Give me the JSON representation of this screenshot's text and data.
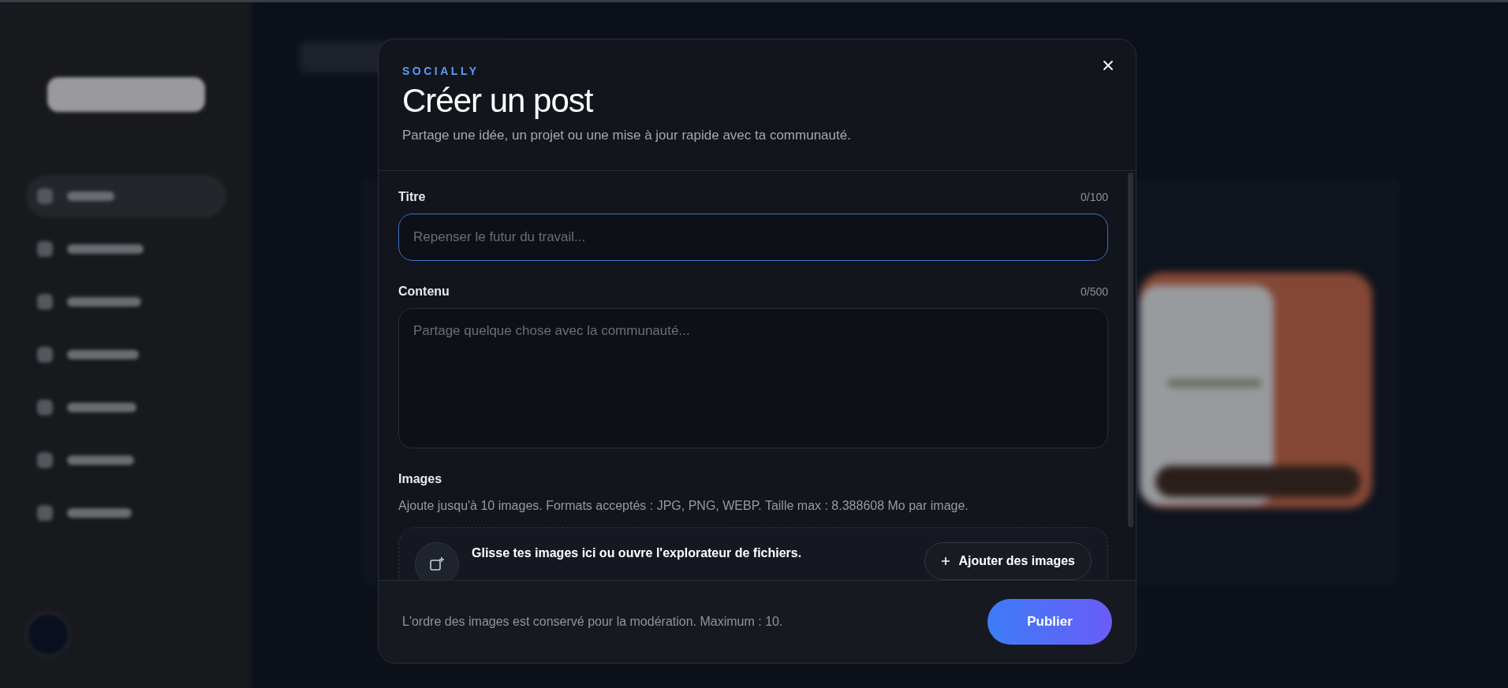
{
  "modal": {
    "brand": "SOCIALLY",
    "title": "Créer un post",
    "subtitle": "Partage une idée, un projet ou une mise à jour rapide avec ta communauté.",
    "fields": [
      {
        "kind": "input",
        "label": "Titre",
        "counter": "0/100",
        "placeholder": "Repenser le futur du travail...",
        "focused": true
      },
      {
        "kind": "textarea",
        "label": "Contenu",
        "counter": "0/500",
        "placeholder": "Partage quelque chose avec la communauté...",
        "focused": false
      }
    ],
    "images": {
      "label": "Images",
      "hint": "Ajoute jusqu'à 10 images. Formats acceptés : JPG, PNG, WEBP. Taille max : 8.388608 Mo par image.",
      "dropzone_text": "Glisse tes images ici ou ouvre l'explorateur de fichiers.",
      "button": "Ajouter des images"
    },
    "footer": {
      "note": "L'ordre des images est conservé pour la modération. Maximum : 10.",
      "button": "Publier"
    }
  }
}
